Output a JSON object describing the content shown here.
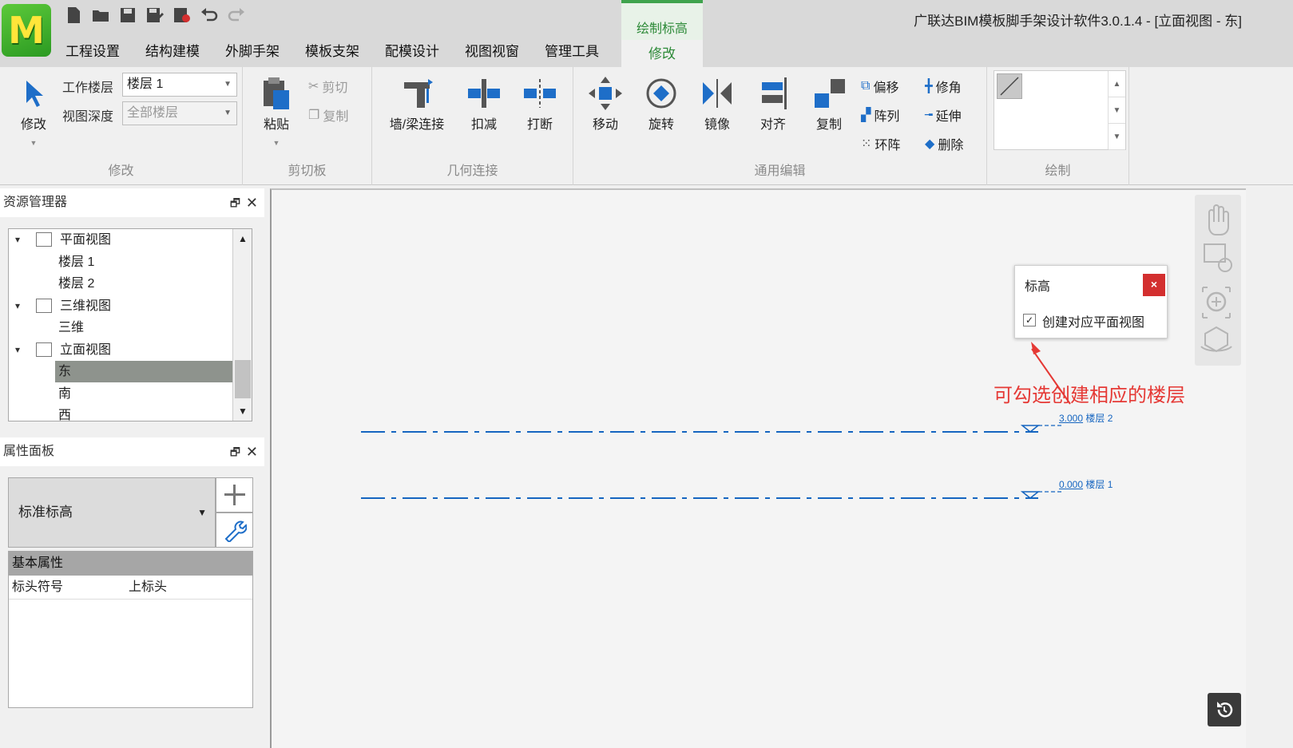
{
  "window": {
    "title": "广联达BIM模板脚手架设计软件3.0.1.4 - [立面视图 - 东]",
    "logo_letter": "M"
  },
  "quick_access": [
    "new-file-icon",
    "open-folder-icon",
    "save-icon",
    "save-as-icon",
    "close-file-icon",
    "undo-icon",
    "redo-icon"
  ],
  "menu": [
    "工程设置",
    "结构建模",
    "外脚手架",
    "模板支架",
    "配模设计",
    "视图视窗",
    "管理工具"
  ],
  "context_tab": {
    "label": "绘制标高",
    "selected": "修改"
  },
  "ribbon": {
    "modify_group": {
      "label": "修改",
      "modify_button": "修改",
      "work_floor_label": "工作楼层",
      "work_floor_value": "楼层 1",
      "view_depth_label": "视图深度",
      "view_depth_value": "全部楼层"
    },
    "clipboard_group": {
      "label": "剪切板",
      "paste": "粘贴",
      "cut": "剪切",
      "copy": "复制"
    },
    "geometry_group": {
      "label": "几何连接",
      "wall_beam_join": "墙/梁连接",
      "deduct": "扣减",
      "break": "打断"
    },
    "edit_group": {
      "label": "通用编辑",
      "move": "移动",
      "rotate": "旋转",
      "mirror": "镜像",
      "align": "对齐",
      "copy": "复制",
      "offset": "偏移",
      "array": "阵列",
      "ring_array": "环阵",
      "trim_corner": "修角",
      "extend": "延伸",
      "delete": "删除"
    },
    "draw_group": {
      "label": "绘制"
    }
  },
  "resource_manager": {
    "title": "资源管理器",
    "tree": [
      {
        "label": "平面视图",
        "type": "folder"
      },
      {
        "label": "楼层 1",
        "type": "item"
      },
      {
        "label": "楼层 2",
        "type": "item"
      },
      {
        "label": "三维视图",
        "type": "folder"
      },
      {
        "label": "三维",
        "type": "item"
      },
      {
        "label": "立面视图",
        "type": "folder"
      },
      {
        "label": "东",
        "type": "item",
        "selected": true
      },
      {
        "label": "南",
        "type": "item"
      },
      {
        "label": "西",
        "type": "item"
      }
    ]
  },
  "properties_panel": {
    "title": "属性面板",
    "type_selector": "标准标高",
    "section_header": "基本属性",
    "rows": [
      {
        "name": "标头符号",
        "value": "上标头"
      }
    ]
  },
  "canvas": {
    "levels": [
      {
        "elevation": "3.000",
        "name": "楼层 2"
      },
      {
        "elevation": "0.000",
        "name": "楼层 1"
      }
    ],
    "level_color": "#1565c0"
  },
  "level_dialog": {
    "title": "标高",
    "checkbox_label": "创建对应平面视图",
    "checked": true,
    "checkmark": "✓",
    "close": "×"
  },
  "annotation": {
    "text": "可勾选创建相应的楼层",
    "color": "#e53935"
  }
}
